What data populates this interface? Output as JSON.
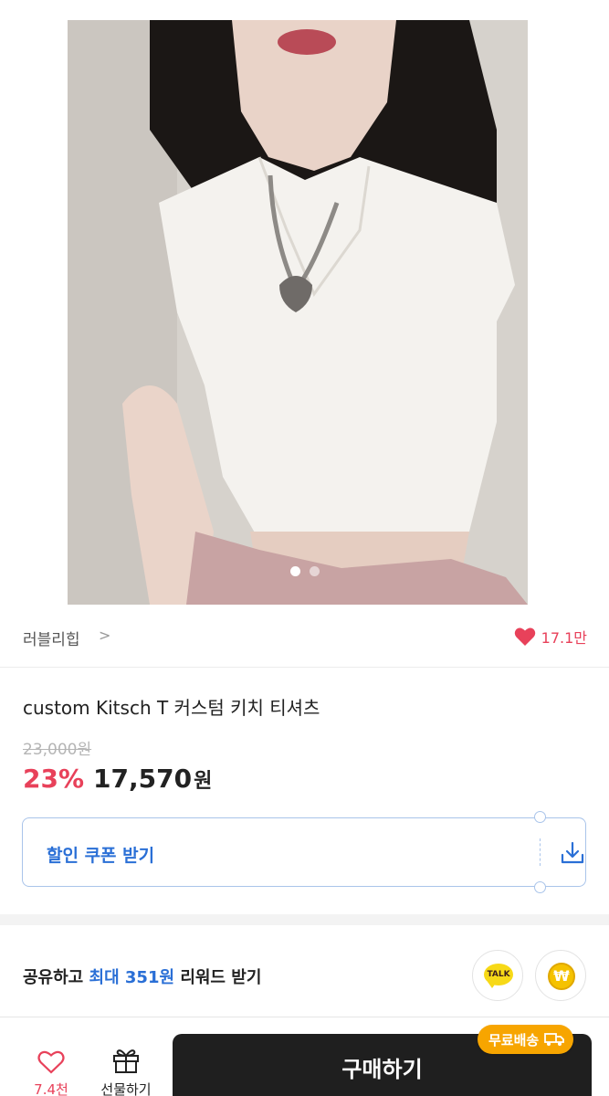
{
  "gallery": {
    "image_alt": "custom Kitsch T 커스텀 키치 티셔츠",
    "dot_count": 2,
    "active_index": 0
  },
  "seller": {
    "name": "러블리힙",
    "chevron": ">",
    "like_count": "17.1만"
  },
  "product": {
    "title": "custom Kitsch T 커스텀 키치 티셔츠",
    "original_price": "23,000원",
    "discount": "23%",
    "price": "17,570",
    "currency": "원"
  },
  "coupon": {
    "label": "할인 쿠폰 받기"
  },
  "share": {
    "prefix": "공유하고 ",
    "highlight": "최대 351원",
    "suffix": " 리워드 받기",
    "kakao_label": "TALK",
    "pay_symbol": "₩"
  },
  "bottom_bar": {
    "like_label": "7.4천",
    "gift_label": "선물하기",
    "buy_label": "구매하기",
    "free_shipping_label": "무료배송"
  },
  "colors": {
    "accent_red": "#e8415a",
    "accent_blue": "#2a6fd6",
    "badge_orange": "#f7a500",
    "buy_button": "#1f1f1f"
  }
}
